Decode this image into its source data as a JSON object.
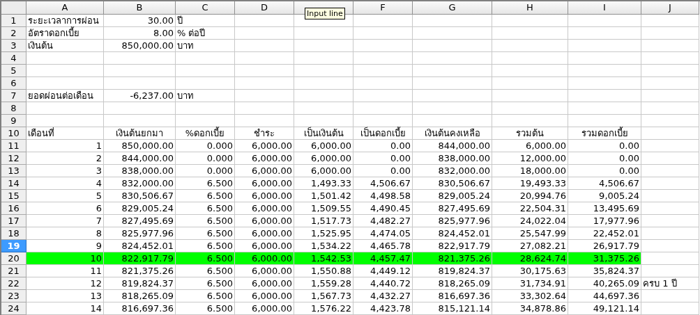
{
  "columns": [
    {
      "label": "A"
    },
    {
      "label": "B"
    },
    {
      "label": "C"
    },
    {
      "label": "D"
    },
    {},
    {
      "label": "F"
    },
    {
      "label": "G"
    },
    {
      "label": "H"
    },
    {
      "label": "I"
    },
    {
      "label": "J"
    }
  ],
  "tooltip": {
    "text": "Input line"
  },
  "rows": [
    {
      "number": "1",
      "selected": false,
      "highlighted": false,
      "kind": "parameter",
      "label": "ระยะเวลาการผ่อน",
      "value": "30.00",
      "unit": "ปี"
    },
    {
      "number": "2",
      "selected": false,
      "highlighted": false,
      "kind": "parameter",
      "label": "อัตราดอกเบี้ย",
      "value": "8.00",
      "unit": "% ต่อปี"
    },
    {
      "number": "3",
      "selected": false,
      "highlighted": false,
      "kind": "parameter",
      "label": "เงินต้น",
      "value": "850,000.00",
      "unit": "บาท"
    },
    {
      "number": "4",
      "selected": false,
      "highlighted": false,
      "kind": "blank"
    },
    {
      "number": "5",
      "selected": false,
      "highlighted": false,
      "kind": "blank"
    },
    {
      "number": "6",
      "selected": false,
      "highlighted": false,
      "kind": "blank"
    },
    {
      "number": "7",
      "selected": false,
      "highlighted": false,
      "kind": "parameter",
      "label": "ยอดผ่อนต่อเดือน",
      "value": "-6,237.00",
      "unit": "บาท"
    },
    {
      "number": "8",
      "selected": false,
      "highlighted": false,
      "kind": "blank"
    },
    {
      "number": "9",
      "selected": false,
      "highlighted": false,
      "kind": "blank"
    },
    {
      "number": "10",
      "selected": false,
      "highlighted": false,
      "kind": "header",
      "label": "เดือนที่",
      "headings": [
        "เงินต้นยกมา",
        "%ดอกเบี้ย",
        "ชำระ",
        "เป็นเงินต้น",
        "เป็นดอกเบี้ย",
        "เงินต้นคงเหลือ",
        "รวมต้น",
        "รวมดอกเบี้ย"
      ]
    },
    {
      "number": "11",
      "selected": false,
      "highlighted": false,
      "kind": "values",
      "values": [
        "1",
        "850,000.00",
        "0.000",
        "6,000.00",
        "6,000.00",
        "0.00",
        "844,000.00",
        "6,000.00",
        "0.00"
      ]
    },
    {
      "number": "12",
      "selected": false,
      "highlighted": false,
      "kind": "values",
      "values": [
        "2",
        "844,000.00",
        "0.000",
        "6,000.00",
        "6,000.00",
        "0.00",
        "838,000.00",
        "12,000.00",
        "0.00"
      ]
    },
    {
      "number": "13",
      "selected": false,
      "highlighted": false,
      "kind": "values",
      "values": [
        "3",
        "838,000.00",
        "0.000",
        "6,000.00",
        "6,000.00",
        "0.00",
        "832,000.00",
        "18,000.00",
        "0.00"
      ]
    },
    {
      "number": "14",
      "selected": false,
      "highlighted": false,
      "kind": "values",
      "values": [
        "4",
        "832,000.00",
        "6.500",
        "6,000.00",
        "1,493.33",
        "4,506.67",
        "830,506.67",
        "19,493.33",
        "4,506.67"
      ]
    },
    {
      "number": "15",
      "selected": false,
      "highlighted": false,
      "kind": "values",
      "values": [
        "5",
        "830,506.67",
        "6.500",
        "6,000.00",
        "1,501.42",
        "4,498.58",
        "829,005.24",
        "20,994.76",
        "9,005.24"
      ]
    },
    {
      "number": "16",
      "selected": false,
      "highlighted": false,
      "kind": "values",
      "values": [
        "6",
        "829,005.24",
        "6.500",
        "6,000.00",
        "1,509.55",
        "4,490.45",
        "827,495.69",
        "22,504.31",
        "13,495.69"
      ]
    },
    {
      "number": "17",
      "selected": false,
      "highlighted": false,
      "kind": "values",
      "values": [
        "7",
        "827,495.69",
        "6.500",
        "6,000.00",
        "1,517.73",
        "4,482.27",
        "825,977.96",
        "24,022.04",
        "17,977.96"
      ]
    },
    {
      "number": "18",
      "selected": false,
      "highlighted": false,
      "kind": "values",
      "values": [
        "8",
        "825,977.96",
        "6.500",
        "6,000.00",
        "1,525.95",
        "4,474.05",
        "824,452.01",
        "25,547.99",
        "22,452.01"
      ]
    },
    {
      "number": "19",
      "selected": true,
      "highlighted": false,
      "kind": "values",
      "values": [
        "9",
        "824,452.01",
        "6.500",
        "6,000.00",
        "1,534.22",
        "4,465.78",
        "822,917.79",
        "27,082.21",
        "26,917.79"
      ]
    },
    {
      "number": "20",
      "selected": false,
      "highlighted": true,
      "kind": "values",
      "values": [
        "10",
        "822,917.79",
        "6.500",
        "6,000.00",
        "1,542.53",
        "4,457.47",
        "821,375.26",
        "28,624.74",
        "31,375.26"
      ]
    },
    {
      "number": "21",
      "selected": false,
      "highlighted": false,
      "kind": "values",
      "values": [
        "11",
        "821,375.26",
        "6.500",
        "6,000.00",
        "1,550.88",
        "4,449.12",
        "819,824.37",
        "30,175.63",
        "35,824.37"
      ]
    },
    {
      "number": "22",
      "selected": false,
      "highlighted": false,
      "kind": "values",
      "values": [
        "12",
        "819,824.37",
        "6.500",
        "6,000.00",
        "1,559.28",
        "4,440.72",
        "818,265.09",
        "31,734.91",
        "40,265.09"
      ],
      "note": "ครบ 1 ปี"
    },
    {
      "number": "23",
      "selected": false,
      "highlighted": false,
      "kind": "values",
      "values": [
        "13",
        "818,265.09",
        "6.500",
        "6,000.00",
        "1,567.73",
        "4,432.27",
        "816,697.36",
        "33,302.64",
        "44,697.36"
      ]
    },
    {
      "number": "24",
      "selected": false,
      "highlighted": false,
      "kind": "values",
      "values": [
        "14",
        "816,697.36",
        "6.500",
        "6,000.00",
        "1,576.22",
        "4,423.78",
        "815,121.14",
        "34,878.86",
        "49,121.14"
      ]
    }
  ]
}
